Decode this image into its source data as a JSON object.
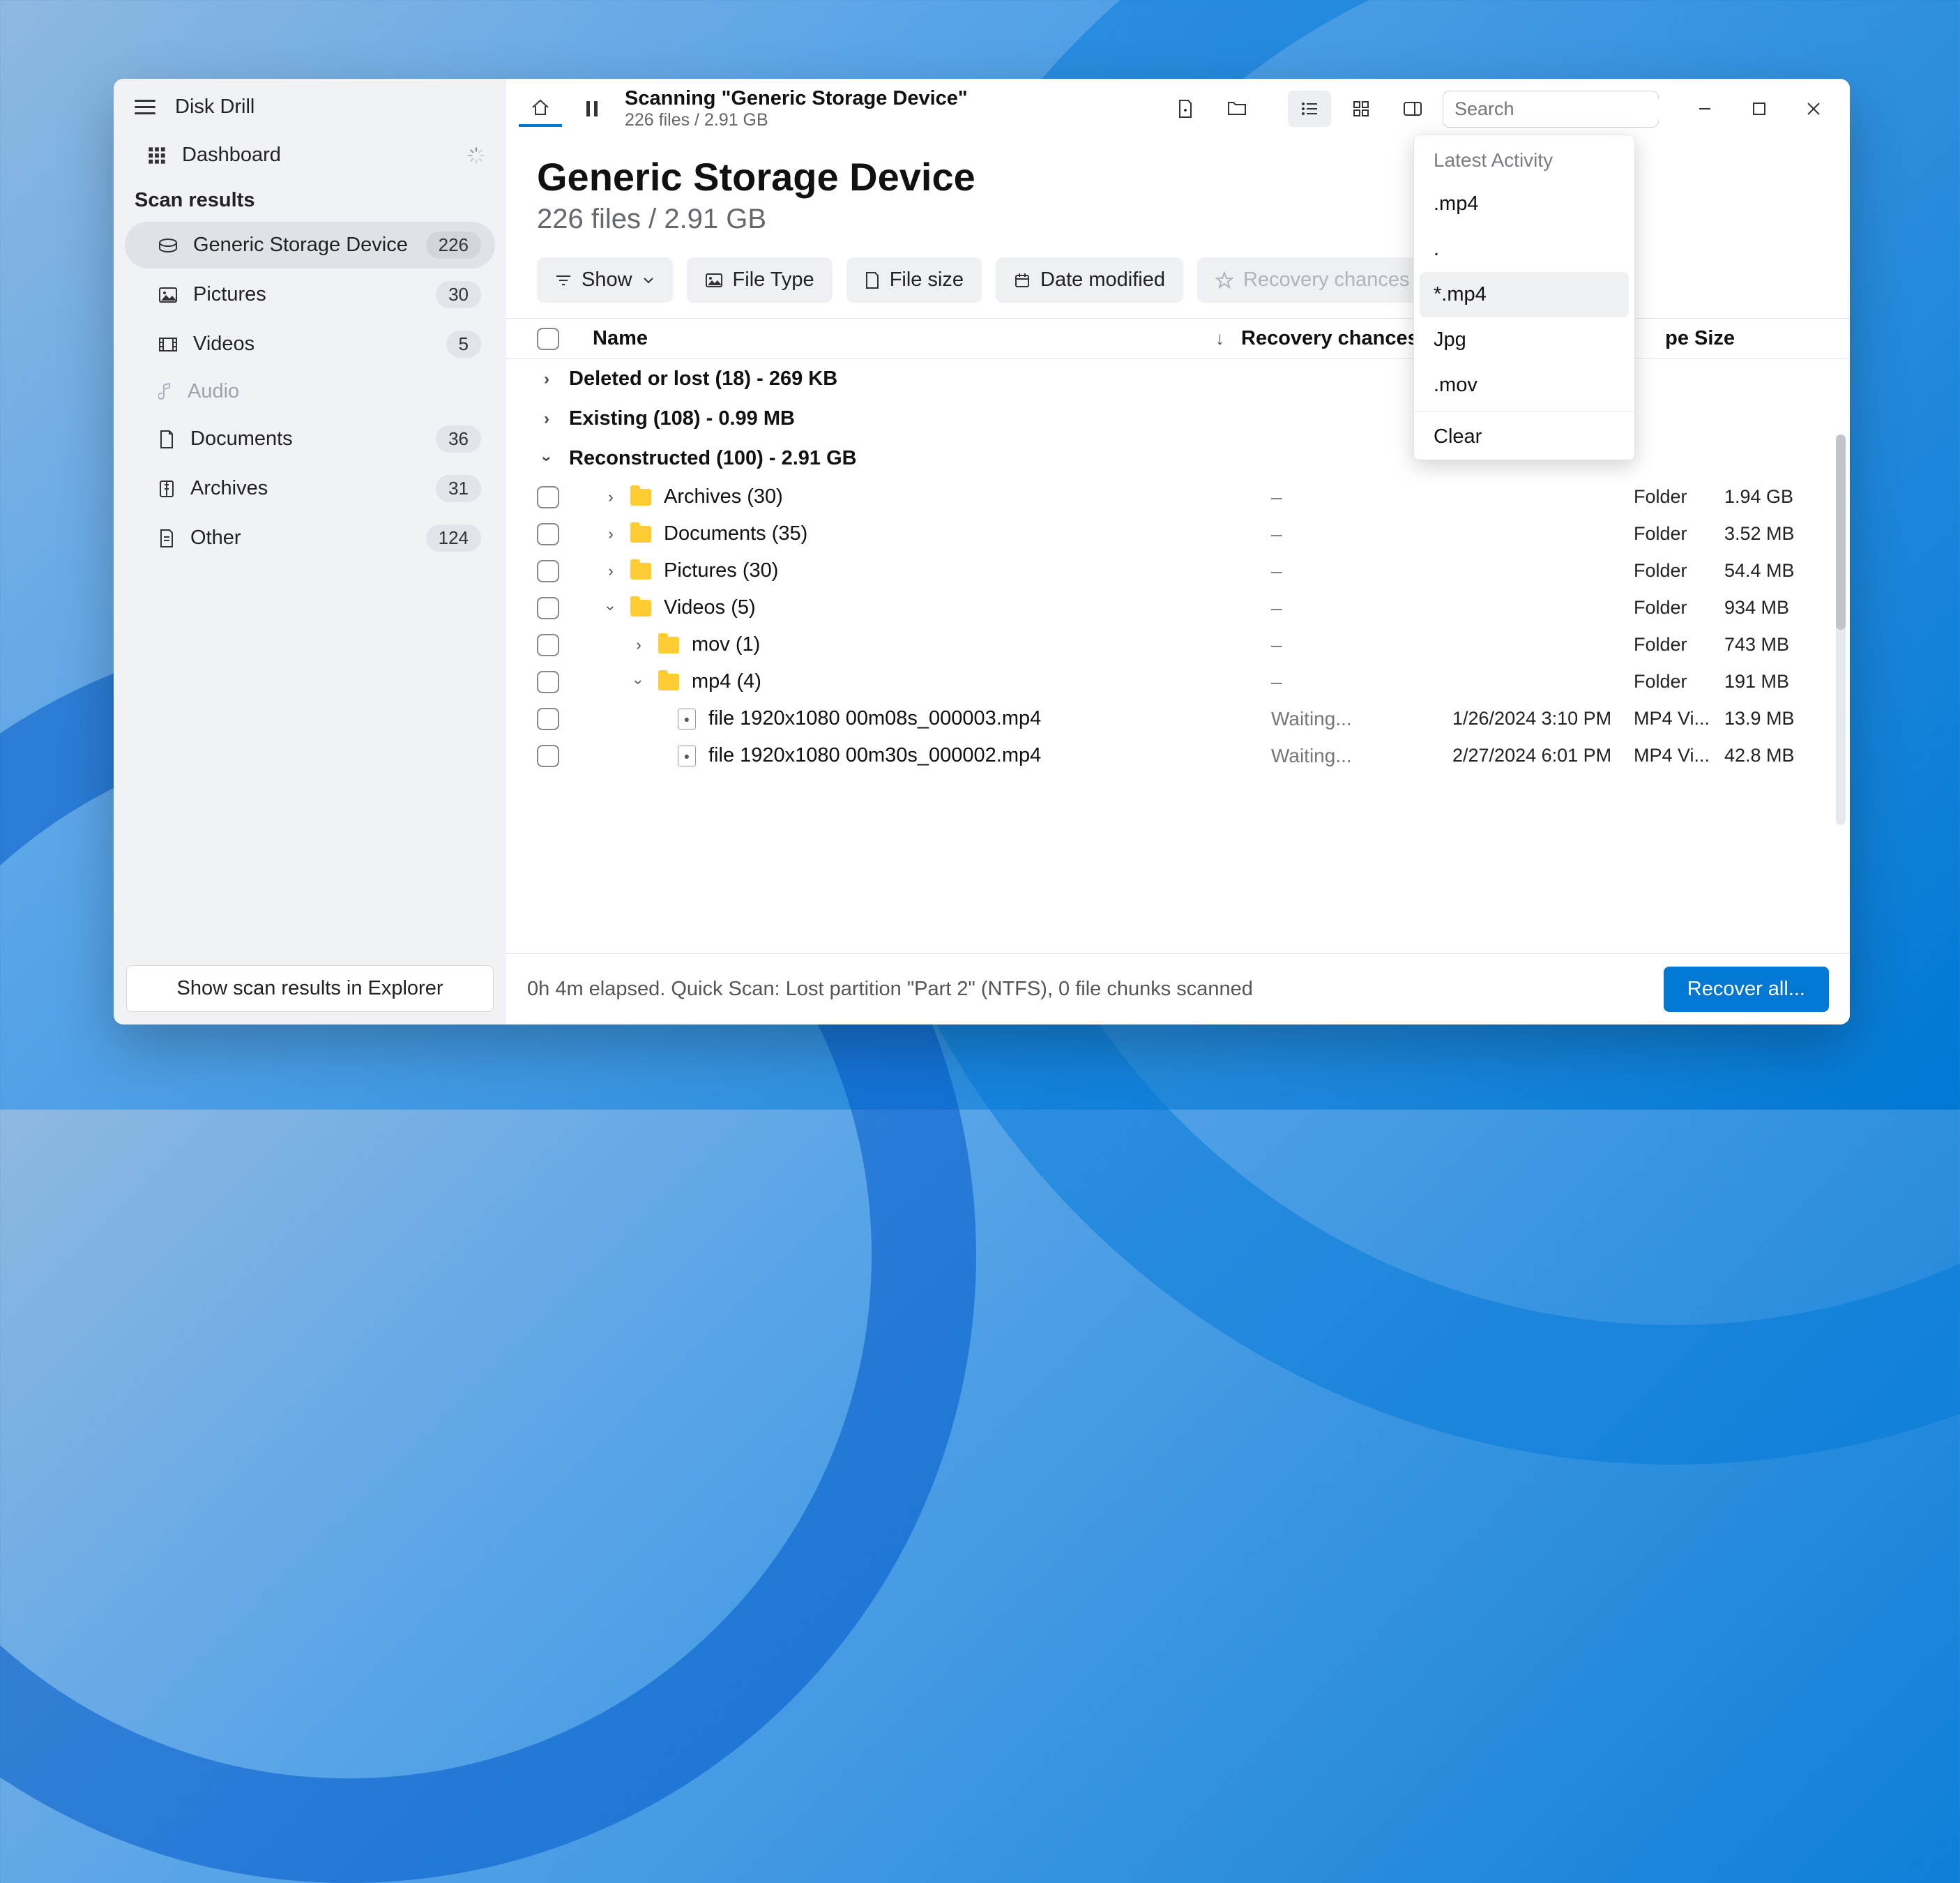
{
  "app": {
    "title": "Disk Drill"
  },
  "sidebar": {
    "dashboard": "Dashboard",
    "section": "Scan results",
    "items": [
      {
        "label": "Generic Storage Device",
        "count": "226",
        "icon": "disk-icon",
        "active": true
      },
      {
        "label": "Pictures",
        "count": "30",
        "icon": "picture-icon"
      },
      {
        "label": "Videos",
        "count": "5",
        "icon": "video-icon"
      },
      {
        "label": "Audio",
        "count": "",
        "icon": "audio-icon",
        "muted": true
      },
      {
        "label": "Documents",
        "count": "36",
        "icon": "document-icon"
      },
      {
        "label": "Archives",
        "count": "31",
        "icon": "archive-icon"
      },
      {
        "label": "Other",
        "count": "124",
        "icon": "other-icon"
      }
    ],
    "footer_btn": "Show scan results in Explorer"
  },
  "toolbar": {
    "scan_title": "Scanning \"Generic Storage Device\"",
    "scan_sub": "226 files / 2.91 GB",
    "search_placeholder": "Search"
  },
  "header": {
    "title": "Generic Storage Device",
    "subtitle": "226 files / 2.91 GB"
  },
  "filters": {
    "show": "Show",
    "file_type": "File Type",
    "file_size": "File size",
    "date_modified": "Date modified",
    "recovery_chances": "Recovery chances"
  },
  "columns": {
    "name": "Name",
    "recovery_chances": "Recovery chances",
    "type_suffix": "pe",
    "size": "Size"
  },
  "groups": {
    "g0": "Deleted or lost (18) - 269 KB",
    "g1": "Existing (108) - 0.99 MB",
    "g2": "Reconstructed (100) - 2.91 GB"
  },
  "rows": {
    "r0": {
      "name": "Archives (30)",
      "rc": "–",
      "type": "Folder",
      "size": "1.94 GB"
    },
    "r1": {
      "name": "Documents (35)",
      "rc": "–",
      "type": "Folder",
      "size": "3.52 MB"
    },
    "r2": {
      "name": "Pictures (30)",
      "rc": "–",
      "type": "Folder",
      "size": "54.4 MB"
    },
    "r3": {
      "name": "Videos (5)",
      "rc": "–",
      "type": "Folder",
      "size": "934 MB"
    },
    "r4": {
      "name": "mov (1)",
      "rc": "–",
      "type": "Folder",
      "size": "743 MB"
    },
    "r5": {
      "name": "mp4 (4)",
      "rc": "–",
      "type": "Folder",
      "size": "191 MB"
    },
    "r6": {
      "name": "file 1920x1080 00m08s_000003.mp4",
      "rc": "Waiting...",
      "date": "1/26/2024 3:10 PM",
      "type": "MP4 Vi...",
      "size": "13.9 MB"
    },
    "r7": {
      "name": "file 1920x1080 00m30s_000002.mp4",
      "rc": "Waiting...",
      "date": "2/27/2024 6:01 PM",
      "type": "MP4 Vi...",
      "size": "42.8 MB"
    }
  },
  "dropdown": {
    "header": "Latest Activity",
    "i0": ".mp4",
    "i1": ".",
    "i2": "*.mp4",
    "i3": "Jpg",
    "i4": ".mov",
    "clear": "Clear"
  },
  "footer": {
    "status": "0h 4m elapsed. Quick Scan: Lost partition \"Part 2\" (NTFS), 0 file chunks scanned",
    "recover": "Recover all..."
  }
}
